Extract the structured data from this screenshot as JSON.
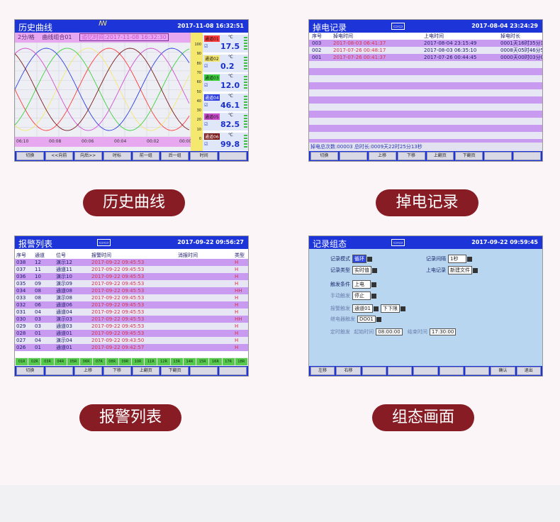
{
  "screens": {
    "history": {
      "title": "历史曲线",
      "datetime": "2017-11-08 16:32:51",
      "logo": "ꟿ",
      "sub_scale": "2分/格",
      "sub_group": "曲线组合01",
      "sub_memory": "追忆时间:2017-11-08 16:32:30",
      "y_ticks": [
        "100",
        "90",
        "80",
        "70",
        "60",
        "50",
        "40",
        "30",
        "20",
        "10",
        "0"
      ],
      "x_ticks": [
        "06:10",
        "00:08",
        "00:06",
        "00:04",
        "00:02",
        "00:00"
      ],
      "channels": [
        {
          "label": "通道01",
          "value": "17.5",
          "unit": "℃",
          "color": "#ff3b3b"
        },
        {
          "label": "通道02",
          "value": "0.2",
          "unit": "℃",
          "color": "#f5e86e"
        },
        {
          "label": "通道03",
          "value": "12.0",
          "unit": "℃",
          "color": "#3fd23f"
        },
        {
          "label": "通道04",
          "value": "46.1",
          "unit": "℃",
          "color": "#2f3fe0"
        },
        {
          "label": "通道05",
          "value": "82.5",
          "unit": "℃",
          "color": "#d050d0"
        },
        {
          "label": "通道06",
          "value": "99.8",
          "unit": "℃",
          "color": "#7a1b1b"
        }
      ],
      "buttons": [
        "切换",
        "<<向前",
        "向后>>",
        "时标",
        "前一组",
        "后一组",
        "时间",
        ""
      ]
    },
    "power": {
      "title": "掉电记录",
      "datetime": "2017-08-04 23:24:29",
      "headers": [
        "序号",
        "掉电时间",
        "上电时间",
        "掉电时长"
      ],
      "rows": [
        [
          "003",
          "2017-08-03 06:41:37",
          "2017-08-04 23:15:49",
          "0001天16时35分12秒"
        ],
        [
          "002",
          "2017-07-26 00:48:17",
          "2017-08-03 06:35:10",
          "0008天05时46分53秒"
        ],
        [
          "001",
          "2017-07-26 00:41:37",
          "2017-07-26 00:44:45",
          "0000天00时03分08秒"
        ]
      ],
      "footer": "掉电总次数:00003   总时长:0009天22时25分13秒",
      "buttons": [
        "切换",
        "",
        "上移",
        "下移",
        "上翻页",
        "下翻页",
        "",
        ""
      ]
    },
    "alarm": {
      "title": "报警列表",
      "datetime": "2017-09-22 09:56:27",
      "headers": [
        "序号",
        "通道",
        "位号",
        "报警时间",
        "消报时间",
        "类型"
      ],
      "rows": [
        [
          "038",
          "12",
          "演示12",
          "2017-09-22 09:45:53",
          "",
          "H"
        ],
        [
          "037",
          "11",
          "通道11",
          "2017-09-22 09:45:53",
          "",
          "H"
        ],
        [
          "036",
          "10",
          "演示10",
          "2017-09-22 09:45:53",
          "",
          "H"
        ],
        [
          "035",
          "09",
          "演示09",
          "2017-09-22 09:45:53",
          "",
          "H"
        ],
        [
          "034",
          "08",
          "通道08",
          "2017-09-22 09:45:53",
          "",
          "HH"
        ],
        [
          "033",
          "08",
          "演示08",
          "2017-09-22 09:45:53",
          "",
          "H"
        ],
        [
          "032",
          "06",
          "通道06",
          "2017-09-22 09:45:53",
          "",
          "H"
        ],
        [
          "031",
          "04",
          "通道04",
          "2017-09-22 09:45:53",
          "",
          "H"
        ],
        [
          "030",
          "03",
          "演示03",
          "2017-09-22 09:45:53",
          "",
          "HH"
        ],
        [
          "029",
          "03",
          "通道03",
          "2017-09-22 09:45:53",
          "",
          "H"
        ],
        [
          "028",
          "01",
          "通道01",
          "2017-09-22 09:45:53",
          "",
          "H"
        ],
        [
          "027",
          "04",
          "演示04",
          "2017-09-22 09:43:50",
          "",
          "H"
        ],
        [
          "026",
          "01",
          "通道01",
          "2017-09-22 09:42:57",
          "",
          "H"
        ]
      ],
      "status": [
        "01R",
        "02R",
        "03R",
        "04R",
        "05R",
        "06R",
        "07R",
        "08R",
        "09R",
        "10R",
        "11R",
        "12R",
        "13R",
        "14R",
        "15R",
        "16R",
        "17R",
        "18R"
      ],
      "buttons": [
        "切换",
        "",
        "上移",
        "下移",
        "上翻页",
        "下翻页",
        "",
        ""
      ]
    },
    "config": {
      "title": "记录组态",
      "datetime": "2017-09-22 09:59:45",
      "fields": {
        "mode_label": "记录模式",
        "mode_value": "循环",
        "interval_label": "记录间隔",
        "interval_value": "1秒",
        "type_label": "记录类型",
        "type_value": "实时值",
        "power_label": "上电记录",
        "power_value": "新建文件",
        "trigger_label": "触发条件",
        "trigger_value": "上电",
        "manual_label": "手动触发",
        "manual_value": "停止",
        "alarm_label": "报警触发",
        "alarm_ch": "通道01",
        "alarm_type": "下下限",
        "relay_label": "继电器触发",
        "relay_value": "DO01",
        "timed_label": "定时触发",
        "start_label": "起始时间",
        "start_value": "08:00:00",
        "end_label": "结束时间",
        "end_value": "17:30:00"
      },
      "buttons": [
        "左移",
        "右移",
        "",
        "",
        "",
        "",
        "",
        "确认",
        "退出"
      ]
    }
  },
  "captions": {
    "history": "历史曲线",
    "power": "掉电记录",
    "alarm": "报警列表",
    "config": "组态画面"
  },
  "colors": {
    "title_blue": "#1d35d8",
    "caption_red": "#871c25",
    "row_purple": "#c89af0",
    "date_red": "#d8304a"
  }
}
